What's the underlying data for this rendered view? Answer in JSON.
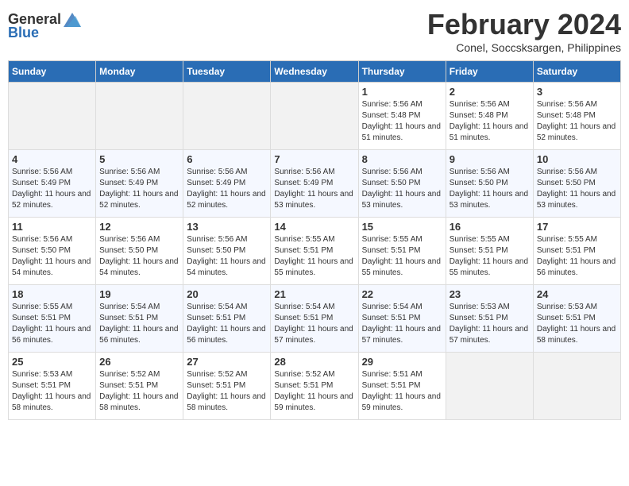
{
  "logo": {
    "general": "General",
    "blue": "Blue"
  },
  "title": "February 2024",
  "subtitle": "Conel, Soccsksargen, Philippines",
  "headers": [
    "Sunday",
    "Monday",
    "Tuesday",
    "Wednesday",
    "Thursday",
    "Friday",
    "Saturday"
  ],
  "weeks": [
    [
      {
        "day": "",
        "sunrise": "",
        "sunset": "",
        "daylight": ""
      },
      {
        "day": "",
        "sunrise": "",
        "sunset": "",
        "daylight": ""
      },
      {
        "day": "",
        "sunrise": "",
        "sunset": "",
        "daylight": ""
      },
      {
        "day": "",
        "sunrise": "",
        "sunset": "",
        "daylight": ""
      },
      {
        "day": "1",
        "sunrise": "Sunrise: 5:56 AM",
        "sunset": "Sunset: 5:48 PM",
        "daylight": "Daylight: 11 hours and 51 minutes."
      },
      {
        "day": "2",
        "sunrise": "Sunrise: 5:56 AM",
        "sunset": "Sunset: 5:48 PM",
        "daylight": "Daylight: 11 hours and 51 minutes."
      },
      {
        "day": "3",
        "sunrise": "Sunrise: 5:56 AM",
        "sunset": "Sunset: 5:48 PM",
        "daylight": "Daylight: 11 hours and 52 minutes."
      }
    ],
    [
      {
        "day": "4",
        "sunrise": "Sunrise: 5:56 AM",
        "sunset": "Sunset: 5:49 PM",
        "daylight": "Daylight: 11 hours and 52 minutes."
      },
      {
        "day": "5",
        "sunrise": "Sunrise: 5:56 AM",
        "sunset": "Sunset: 5:49 PM",
        "daylight": "Daylight: 11 hours and 52 minutes."
      },
      {
        "day": "6",
        "sunrise": "Sunrise: 5:56 AM",
        "sunset": "Sunset: 5:49 PM",
        "daylight": "Daylight: 11 hours and 52 minutes."
      },
      {
        "day": "7",
        "sunrise": "Sunrise: 5:56 AM",
        "sunset": "Sunset: 5:49 PM",
        "daylight": "Daylight: 11 hours and 53 minutes."
      },
      {
        "day": "8",
        "sunrise": "Sunrise: 5:56 AM",
        "sunset": "Sunset: 5:50 PM",
        "daylight": "Daylight: 11 hours and 53 minutes."
      },
      {
        "day": "9",
        "sunrise": "Sunrise: 5:56 AM",
        "sunset": "Sunset: 5:50 PM",
        "daylight": "Daylight: 11 hours and 53 minutes."
      },
      {
        "day": "10",
        "sunrise": "Sunrise: 5:56 AM",
        "sunset": "Sunset: 5:50 PM",
        "daylight": "Daylight: 11 hours and 53 minutes."
      }
    ],
    [
      {
        "day": "11",
        "sunrise": "Sunrise: 5:56 AM",
        "sunset": "Sunset: 5:50 PM",
        "daylight": "Daylight: 11 hours and 54 minutes."
      },
      {
        "day": "12",
        "sunrise": "Sunrise: 5:56 AM",
        "sunset": "Sunset: 5:50 PM",
        "daylight": "Daylight: 11 hours and 54 minutes."
      },
      {
        "day": "13",
        "sunrise": "Sunrise: 5:56 AM",
        "sunset": "Sunset: 5:50 PM",
        "daylight": "Daylight: 11 hours and 54 minutes."
      },
      {
        "day": "14",
        "sunrise": "Sunrise: 5:55 AM",
        "sunset": "Sunset: 5:51 PM",
        "daylight": "Daylight: 11 hours and 55 minutes."
      },
      {
        "day": "15",
        "sunrise": "Sunrise: 5:55 AM",
        "sunset": "Sunset: 5:51 PM",
        "daylight": "Daylight: 11 hours and 55 minutes."
      },
      {
        "day": "16",
        "sunrise": "Sunrise: 5:55 AM",
        "sunset": "Sunset: 5:51 PM",
        "daylight": "Daylight: 11 hours and 55 minutes."
      },
      {
        "day": "17",
        "sunrise": "Sunrise: 5:55 AM",
        "sunset": "Sunset: 5:51 PM",
        "daylight": "Daylight: 11 hours and 56 minutes."
      }
    ],
    [
      {
        "day": "18",
        "sunrise": "Sunrise: 5:55 AM",
        "sunset": "Sunset: 5:51 PM",
        "daylight": "Daylight: 11 hours and 56 minutes."
      },
      {
        "day": "19",
        "sunrise": "Sunrise: 5:54 AM",
        "sunset": "Sunset: 5:51 PM",
        "daylight": "Daylight: 11 hours and 56 minutes."
      },
      {
        "day": "20",
        "sunrise": "Sunrise: 5:54 AM",
        "sunset": "Sunset: 5:51 PM",
        "daylight": "Daylight: 11 hours and 56 minutes."
      },
      {
        "day": "21",
        "sunrise": "Sunrise: 5:54 AM",
        "sunset": "Sunset: 5:51 PM",
        "daylight": "Daylight: 11 hours and 57 minutes."
      },
      {
        "day": "22",
        "sunrise": "Sunrise: 5:54 AM",
        "sunset": "Sunset: 5:51 PM",
        "daylight": "Daylight: 11 hours and 57 minutes."
      },
      {
        "day": "23",
        "sunrise": "Sunrise: 5:53 AM",
        "sunset": "Sunset: 5:51 PM",
        "daylight": "Daylight: 11 hours and 57 minutes."
      },
      {
        "day": "24",
        "sunrise": "Sunrise: 5:53 AM",
        "sunset": "Sunset: 5:51 PM",
        "daylight": "Daylight: 11 hours and 58 minutes."
      }
    ],
    [
      {
        "day": "25",
        "sunrise": "Sunrise: 5:53 AM",
        "sunset": "Sunset: 5:51 PM",
        "daylight": "Daylight: 11 hours and 58 minutes."
      },
      {
        "day": "26",
        "sunrise": "Sunrise: 5:52 AM",
        "sunset": "Sunset: 5:51 PM",
        "daylight": "Daylight: 11 hours and 58 minutes."
      },
      {
        "day": "27",
        "sunrise": "Sunrise: 5:52 AM",
        "sunset": "Sunset: 5:51 PM",
        "daylight": "Daylight: 11 hours and 58 minutes."
      },
      {
        "day": "28",
        "sunrise": "Sunrise: 5:52 AM",
        "sunset": "Sunset: 5:51 PM",
        "daylight": "Daylight: 11 hours and 59 minutes."
      },
      {
        "day": "29",
        "sunrise": "Sunrise: 5:51 AM",
        "sunset": "Sunset: 5:51 PM",
        "daylight": "Daylight: 11 hours and 59 minutes."
      },
      {
        "day": "",
        "sunrise": "",
        "sunset": "",
        "daylight": ""
      },
      {
        "day": "",
        "sunrise": "",
        "sunset": "",
        "daylight": ""
      }
    ]
  ]
}
